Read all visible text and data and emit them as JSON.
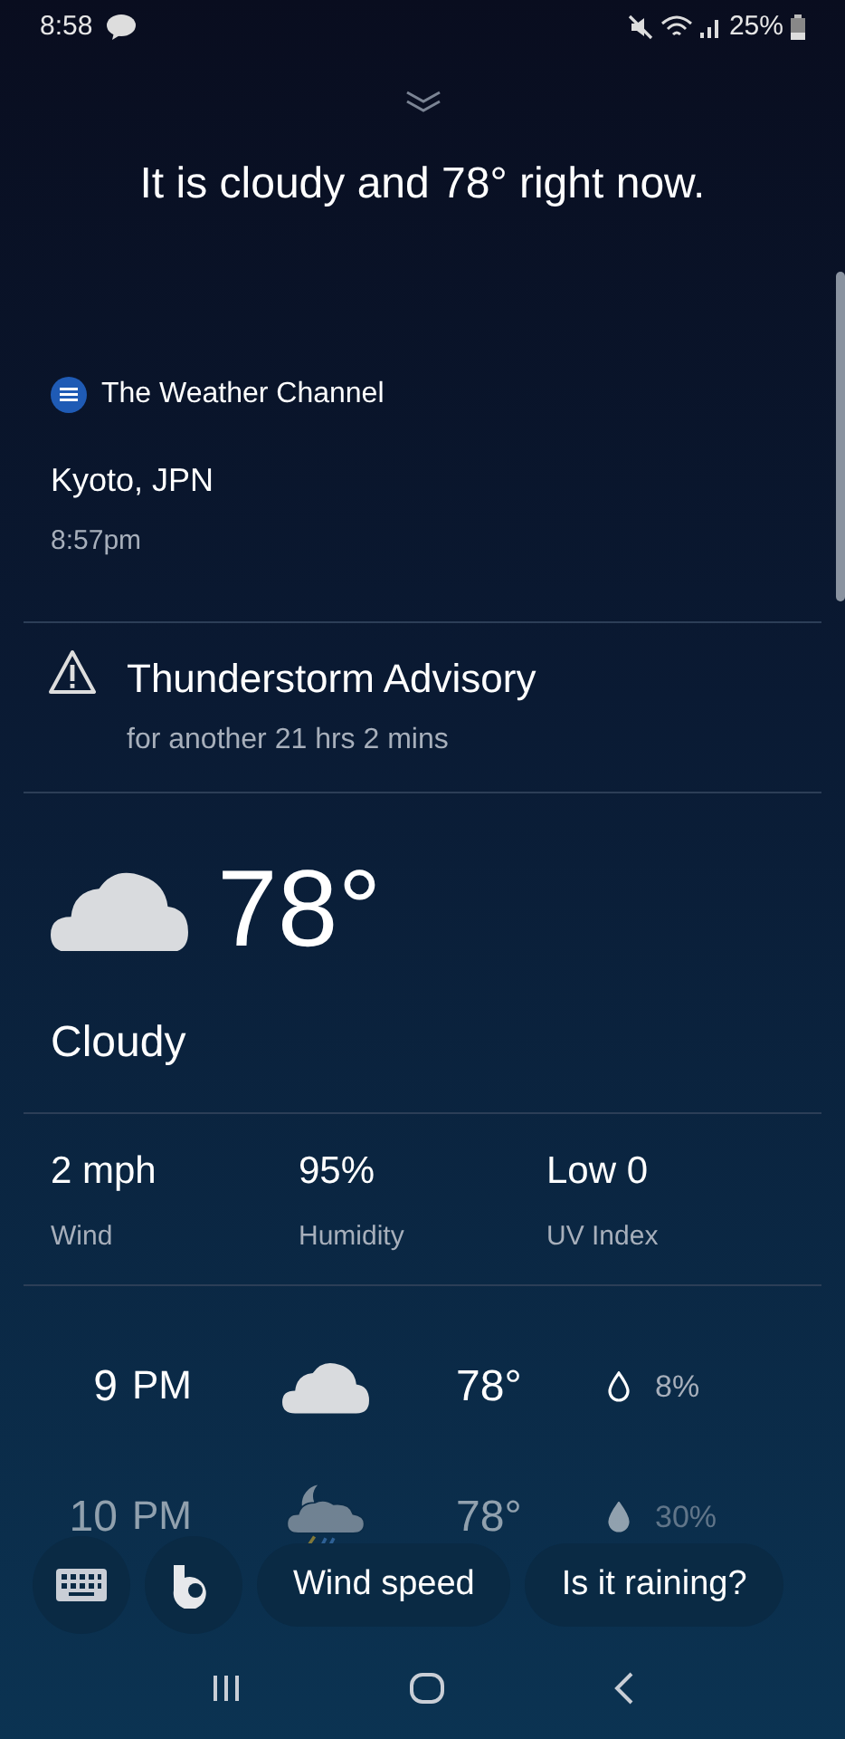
{
  "status_bar": {
    "time": "8:58",
    "battery": "25%"
  },
  "headline": "It is cloudy and 78° right now.",
  "source": {
    "name": "The Weather Channel"
  },
  "location": {
    "place": "Kyoto, JPN",
    "time": "8:57pm"
  },
  "alert": {
    "title": "Thunderstorm Advisory",
    "detail": "for another 21 hrs 2 mins"
  },
  "current": {
    "kind": "cloudy",
    "temperature": "78°",
    "condition": "Cloudy"
  },
  "stats": [
    {
      "value": "2 mph",
      "label": "Wind"
    },
    {
      "value": "95%",
      "label": "Humidity"
    },
    {
      "value": "Low 0",
      "label": "UV Index"
    }
  ],
  "hourly": [
    {
      "hour": "9",
      "period": "PM",
      "kind": "cloudy",
      "temperature": "78°",
      "precipitation": "8%",
      "faded": false
    },
    {
      "hour": "10",
      "period": "PM",
      "kind": "storm",
      "temperature": "78°",
      "precipitation": "30%",
      "faded": true
    }
  ],
  "suggestions": [
    "Wind speed",
    "Is it raining?"
  ]
}
